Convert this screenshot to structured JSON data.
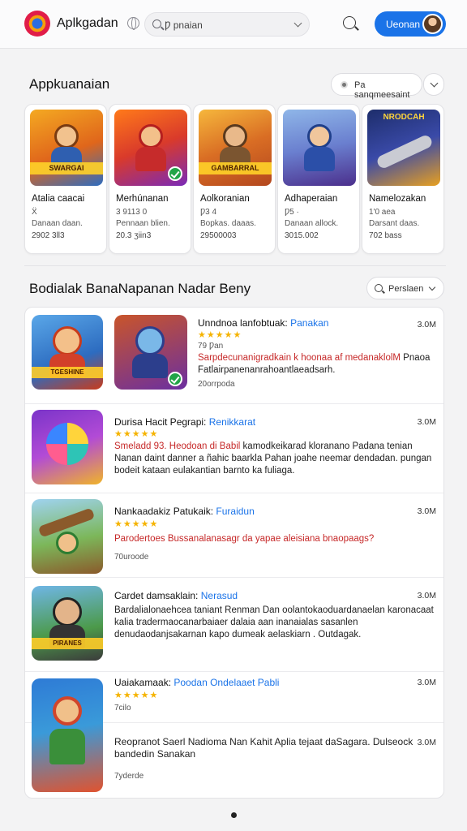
{
  "header": {
    "app_name": "Aplkgadan",
    "search_value": "Ƿ pnaian",
    "user_button": "Ueonan"
  },
  "featured": {
    "title": "Appkuanaian",
    "filter_label": "Pa sanqmeesaint",
    "cards": [
      {
        "title": "Atalia caacai",
        "sub1": "Ẍ",
        "sub2": "Danaan daan.",
        "sub3": "2902 3ll3",
        "art_band": "SWARGAI",
        "colors": [
          "#f4a922",
          "#2d6cc0"
        ]
      },
      {
        "title": "Merhúnanan",
        "sub1": "3 9113 0",
        "sub2": "Pennaan blien.",
        "sub3": "20.3 ʒiin3",
        "art_band": "",
        "colors": [
          "#ff7a1a",
          "#7a2ab8"
        ]
      },
      {
        "title": "Aolkoranian",
        "sub1": "Ƿ3 4",
        "sub2": "Bopkas. daaas.",
        "sub3": "29500003",
        "art_band": "GAMBARRAL",
        "colors": [
          "#f6b73c",
          "#b3471e"
        ]
      },
      {
        "title": "Adhaperaian",
        "sub1": "Ƿ5 ·",
        "sub2": "Danaan allock.",
        "sub3": "3015.002",
        "art_band": "",
        "colors": [
          "#8fb6e8",
          "#4b2f8c"
        ]
      },
      {
        "title": "Namelozakan",
        "sub1": "1'0 aea",
        "sub2": "Darsant daas.",
        "sub3": "702 bass",
        "art_band": "NRODCAH",
        "colors": [
          "#1d2d6b",
          "#e8a020"
        ]
      }
    ]
  },
  "list_section": {
    "title": "Bodialak BanaNapanan Nadar Beny",
    "sort_label": "Perslaen",
    "items": [
      {
        "title": "Unndnoa lanfobtuak:",
        "tag": "Panakan",
        "size": "3.0M",
        "stars": "★★★★★",
        "rating_text": "79 Ƿan",
        "desc_hl": "Sarpdecunanigradkain k hoonaa af medanaklolM",
        "desc_rest": " Pnaoa Fatlairpanenanrahoantlaeadsarh.",
        "meta": "20orrpoda",
        "band": "TGESHINE",
        "colors": [
          "#5aa7e8",
          "#c93b1b"
        ]
      },
      {
        "title": "Durisa Hacit Pegrapi:",
        "tag": "Renikkarat",
        "size": "3.0M",
        "stars": "★★★★★",
        "desc_hl": "Smeladd 93. Heodoan di Babil",
        "desc_rest": " kamodkeikarad kloranano Padana tenian Nanan daint danner a ñahic baarkla Pahan joahe neemar dendadan. pungan bodeit kataan eulakantian barnto ka fuliaga.",
        "band": "",
        "colors": [
          "#7a34c9",
          "#f0b429"
        ]
      },
      {
        "title": "Nankaadakiz Patukaik:",
        "tag": "Furaidun",
        "size": "3.0M",
        "stars": "★★★★★",
        "desc_hl": "Parodertoes Bussanalanasagr da yapae aleisiana bnaopaags?",
        "desc_rest": "",
        "meta": "70uroode",
        "band": "",
        "colors": [
          "#9fc86a",
          "#8b5a2b"
        ]
      },
      {
        "title": "Cardet damsaklain:",
        "tag": "Nerasud",
        "size": "3.0M",
        "stars": "",
        "desc_hl": "",
        "desc_rest": "Bardalialonaehcea taniant Renman Dan oolantokaoduardanaelan karonacaat kalia tradermaocanarbaiaer dalaia aan inanaialas sasanlen denudaodanjsakarnan kapo dumeak aelaskiarn . Outdagak.",
        "band": "PIRANES",
        "colors": [
          "#6fb6e6",
          "#3b3b3b"
        ]
      },
      {
        "title": "Uaiakamaak:",
        "tag": "Poodan Ondelaaet Pabli",
        "size": "3.0M",
        "stars": "★★★★★",
        "meta": "7cilo",
        "band": "",
        "colors": [
          "#2e7bd6",
          "#e0532f"
        ]
      },
      {
        "title": "",
        "tag": "",
        "size": "3.0M",
        "stars": "",
        "desc_hl": "",
        "desc_rest": "Reopranot Saerl Nadioma Nan Kahit Aplia tejaat daSagara. Dulseock bandedin Sanakan",
        "meta": "7yderde",
        "band": "",
        "colors": []
      }
    ]
  },
  "pager": {
    "current": 1
  }
}
